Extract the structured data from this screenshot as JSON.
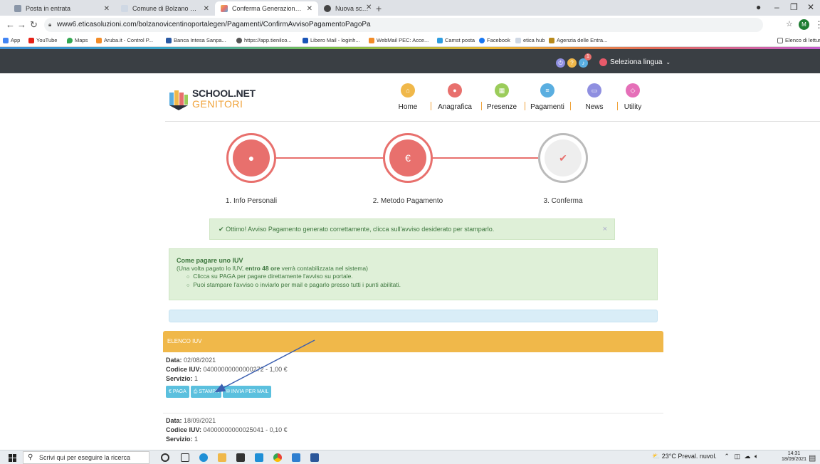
{
  "browser": {
    "tabs": [
      {
        "title": "Posta in entrata",
        "active": false
      },
      {
        "title": "Comune di Bolzano Vicentino - I",
        "active": false
      },
      {
        "title": "Conferma Generazione Avviso pa",
        "active": true
      },
      {
        "title": "Nuova scheda",
        "active": false
      }
    ],
    "url": "www6.eticasoluzioni.com/bolzanovicentinoportalegen/Pagamenti/ConfirmAvvisoPagamentoPagoPa",
    "bookmarks": [
      "App",
      "YouTube",
      "Maps",
      "Aruba.it - Control P...",
      "Banca Intesa Sanpa...",
      "https://app.tienilco...",
      "Libero Mail - loginh...",
      "WebMail PEC: Acce...",
      "Camst posta",
      "Facebook",
      "etica hub",
      "Agenzia delle Entra..."
    ],
    "reading_list": "Elenco di lettura",
    "profile_initial": "M"
  },
  "topbar": {
    "notification_count": "1",
    "language": "Seleziona lingua"
  },
  "logo": {
    "line1": "SCHOOL.NET",
    "line2": "GENITORI"
  },
  "nav": [
    {
      "label": "Home",
      "color": "#f0b84a"
    },
    {
      "label": "Anagrafica",
      "color": "#e8706d"
    },
    {
      "label": "Presenze",
      "color": "#9bcc5a"
    },
    {
      "label": "Pagamenti",
      "color": "#5aaee0"
    },
    {
      "label": "News",
      "color": "#8f8fe0"
    },
    {
      "label": "Utility",
      "color": "#e56fb8"
    }
  ],
  "steps": [
    {
      "label": "1. Info Personali",
      "icon": "user-icon",
      "state": "done"
    },
    {
      "label": "2. Metodo Pagamento",
      "icon": "€",
      "state": "done"
    },
    {
      "label": "3. Conferma",
      "icon": "check-icon",
      "state": "current"
    }
  ],
  "alert": {
    "text": "Ottimo! Avviso Pagamento generato correttamente, clicca sull'avviso desiderato per stamparlo.",
    "close": "×"
  },
  "howto": {
    "title": "Come pagare uno IUV",
    "note_pre": "(Una volta pagato lo IUV, ",
    "note_bold": "entro 48 ore",
    "note_post": " verrà contabilizzata nel sistema)",
    "items": [
      "Clicca su PAGA per pagare direttamente l'avviso su portale.",
      "Puoi stampare l'avviso o inviarlo per mail e pagarlo presso tutti i punti abilitati."
    ]
  },
  "iuv_list": {
    "header": "ELENCO IUV",
    "labels": {
      "data": "Data:",
      "codice": "Codice IUV:",
      "servizio": "Servizio:"
    },
    "buttons": {
      "paga": "€ PAGA",
      "stampa": "STAMPA",
      "mail": "INVIA PER MAIL"
    },
    "entries": [
      {
        "data": "02/08/2021",
        "codice": "04000000000000272 - 1,00 €",
        "servizio": "1"
      },
      {
        "data": "18/09/2021",
        "codice": "04000000000025041 - 0,10 €",
        "servizio": "1"
      }
    ]
  },
  "taskbar": {
    "search_placeholder": "Scrivi qui per eseguire la ricerca",
    "weather": "23°C Preval. nuvol.",
    "time": "14:31",
    "date": "18/09/2021"
  }
}
